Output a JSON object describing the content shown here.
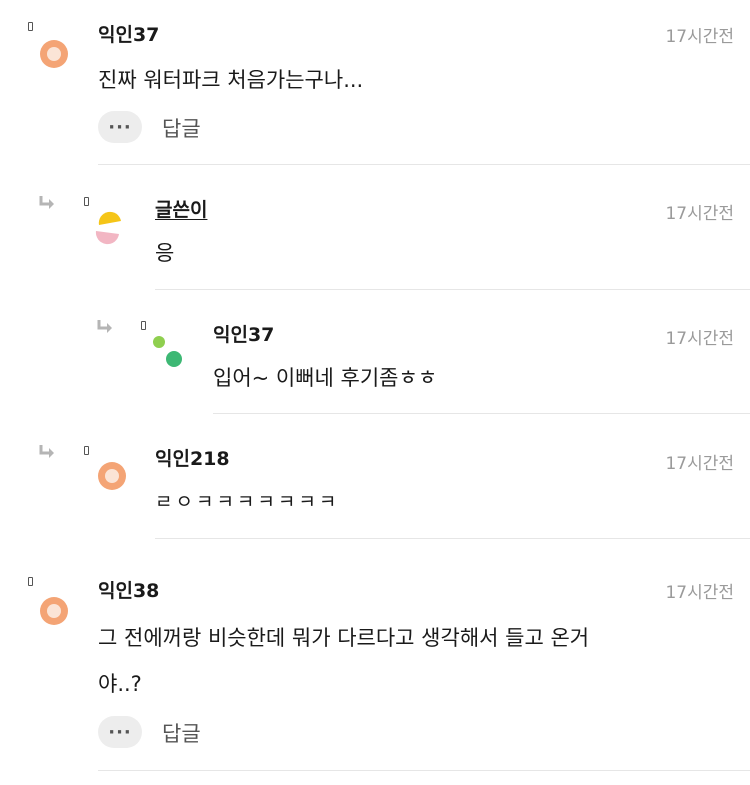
{
  "comments": [
    {
      "name": "익인37",
      "time": "17시간전",
      "text": "진짜 워터파크 처음가는구나...",
      "more": "···",
      "reply": "답글"
    },
    {
      "name": "글쓴이",
      "time": "17시간전",
      "text": "응"
    },
    {
      "name": "익인37",
      "time": "17시간전",
      "text": "입어~ 이뻐네 후기좀ㅎㅎ"
    },
    {
      "name": "익인218",
      "time": "17시간전",
      "text": "ㄹㅇㅋㅋㅋㅋㅋㅋㅋ"
    },
    {
      "name": "익인38",
      "time": "17시간전",
      "text_line1": "그 전에꺼랑 비슷한데 뭐가 다르다고 생각해서 들고 온거",
      "text_line2": "야..?",
      "more": "···",
      "reply": "답글"
    }
  ],
  "colors": {
    "avatar_orange": "#f4a475",
    "author_yellow": "#f5c518",
    "author_pink": "#f2b6c3",
    "dot_lightgreen": "#8fcf4f",
    "dot_green": "#3db874",
    "muted": "#9a9a9a"
  }
}
